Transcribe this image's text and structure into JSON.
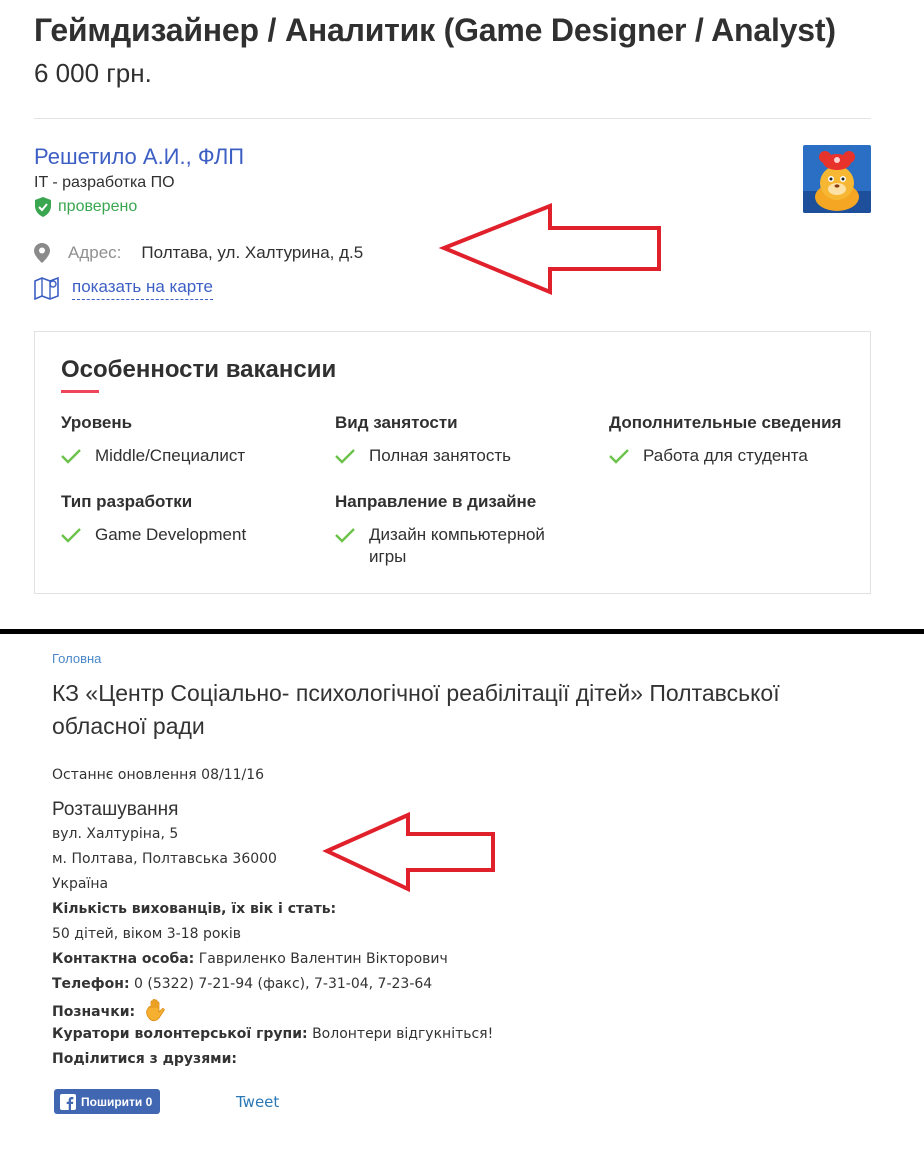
{
  "top": {
    "job_title": "Геймдизайнер / Аналитик (Game Designer / Analyst)",
    "salary": "6 000 грн.",
    "company": {
      "name": "Решетило А.И., ФЛП",
      "category": "IT - разработка ПО",
      "verified": "проверено",
      "logo_icon": "lion-cartoon-logo"
    },
    "address": {
      "label": "Адрес:",
      "value": "Полтава, ул. Халтурина, д.5"
    },
    "map_link": "показать на карте",
    "features": {
      "title": "Особенности вакансии",
      "groups": [
        {
          "heading": "Уровень",
          "items": [
            "Middle/Специалист"
          ]
        },
        {
          "heading": "Вид занятости",
          "items": [
            "Полная занятость"
          ]
        },
        {
          "heading": "Дополнительные сведения",
          "items": [
            "Работа для студента"
          ]
        },
        {
          "heading": "Тип разработки",
          "items": [
            "Game Development"
          ]
        },
        {
          "heading": "Направление в дизайне",
          "items": [
            "Дизайн компьютерной игры"
          ]
        }
      ]
    },
    "accent_color": "#f0445a",
    "link_color": "#3d5fc4",
    "verified_color": "#3aa64f"
  },
  "bottom": {
    "breadcrumb": "Головна",
    "org_title": "КЗ «Центр Соціально- психологічної реабілітації дітей» Полтавської обласної ради",
    "updated": "Останнє оновлення 08/11/16",
    "location_heading": "Розташування",
    "address_lines": [
      "вул. Халтуріна, 5",
      "м. Полтава, Полтавська 36000",
      "Україна"
    ],
    "children_label": "Кількість вихованців, їх вік і стать:",
    "children_value": "50 дітей, віком 3-18 років",
    "contact_label": "Контактна особа:",
    "contact_value": "Гавриленко Валентин Вікторович",
    "phone_label": "Телефон:",
    "phone_value": "0 (5322) 7-21-94 (факс), 7-31-04, 7-23-64",
    "tags_label": "Позначки:",
    "tags_icon": "raised-hand-icon",
    "curators_label": "Куратори волонтерської групи:",
    "curators_value": "Волонтери відгукніться!",
    "share_label": "Поділитися з друзями:",
    "fb_button": "Поширити 0",
    "tweet": "Tweet"
  },
  "annotation_color": "#e0202b"
}
